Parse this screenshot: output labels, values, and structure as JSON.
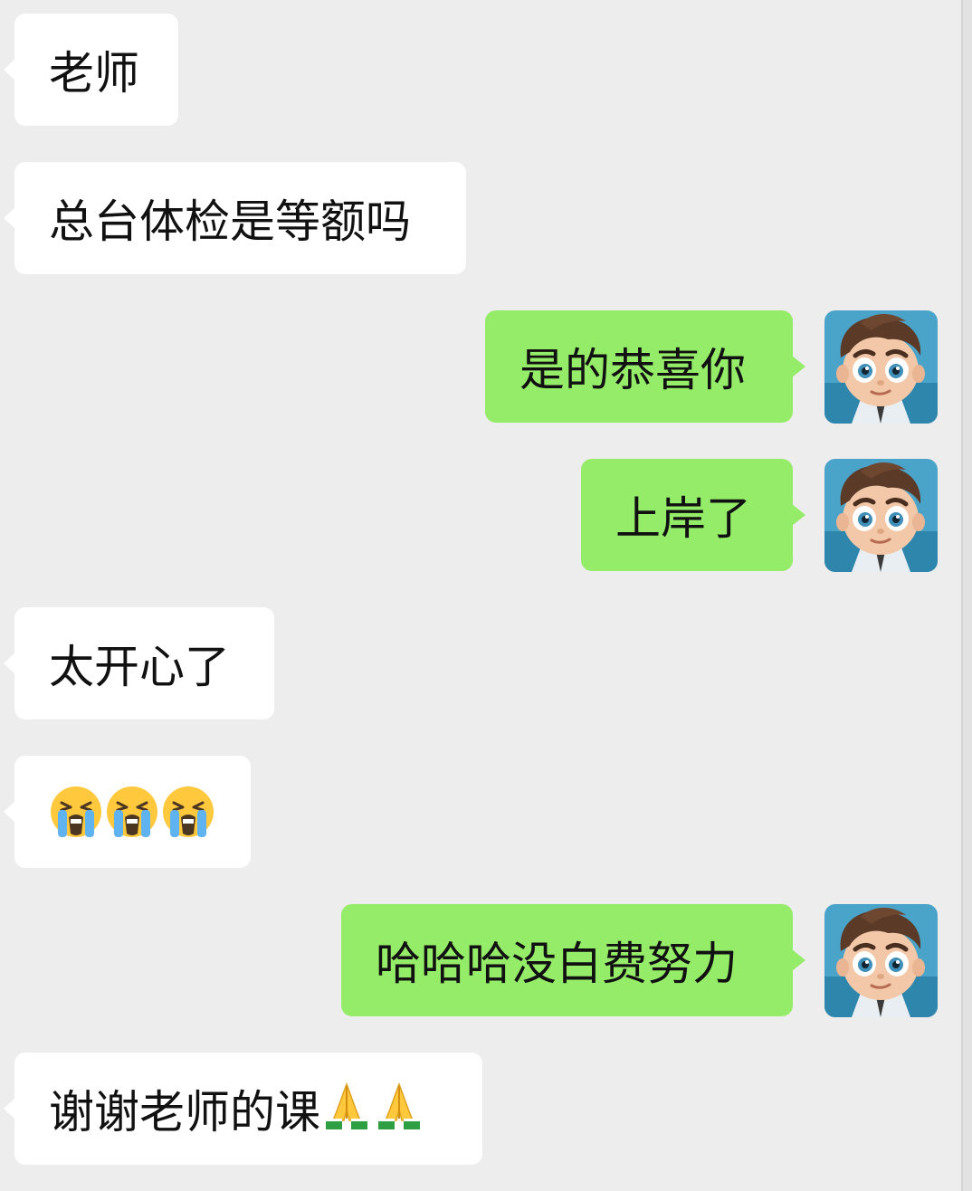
{
  "messages": [
    {
      "side": "left",
      "text": "老师"
    },
    {
      "side": "left",
      "text": "总台体检是等额吗"
    },
    {
      "side": "right",
      "text": "是的恭喜你"
    },
    {
      "side": "right",
      "text": "上岸了"
    },
    {
      "side": "left",
      "text": "太开心了"
    },
    {
      "side": "left",
      "emoji": [
        "loudly-crying-face",
        "loudly-crying-face",
        "loudly-crying-face"
      ]
    },
    {
      "side": "right",
      "text": "哈哈哈没白费努力"
    },
    {
      "side": "left",
      "text": "谢谢老师的课",
      "emoji": [
        "folded-hands",
        "folded-hands"
      ]
    }
  ],
  "colors": {
    "background": "#ededed",
    "incoming_bubble": "#ffffff",
    "outgoing_bubble": "#95ec69"
  }
}
